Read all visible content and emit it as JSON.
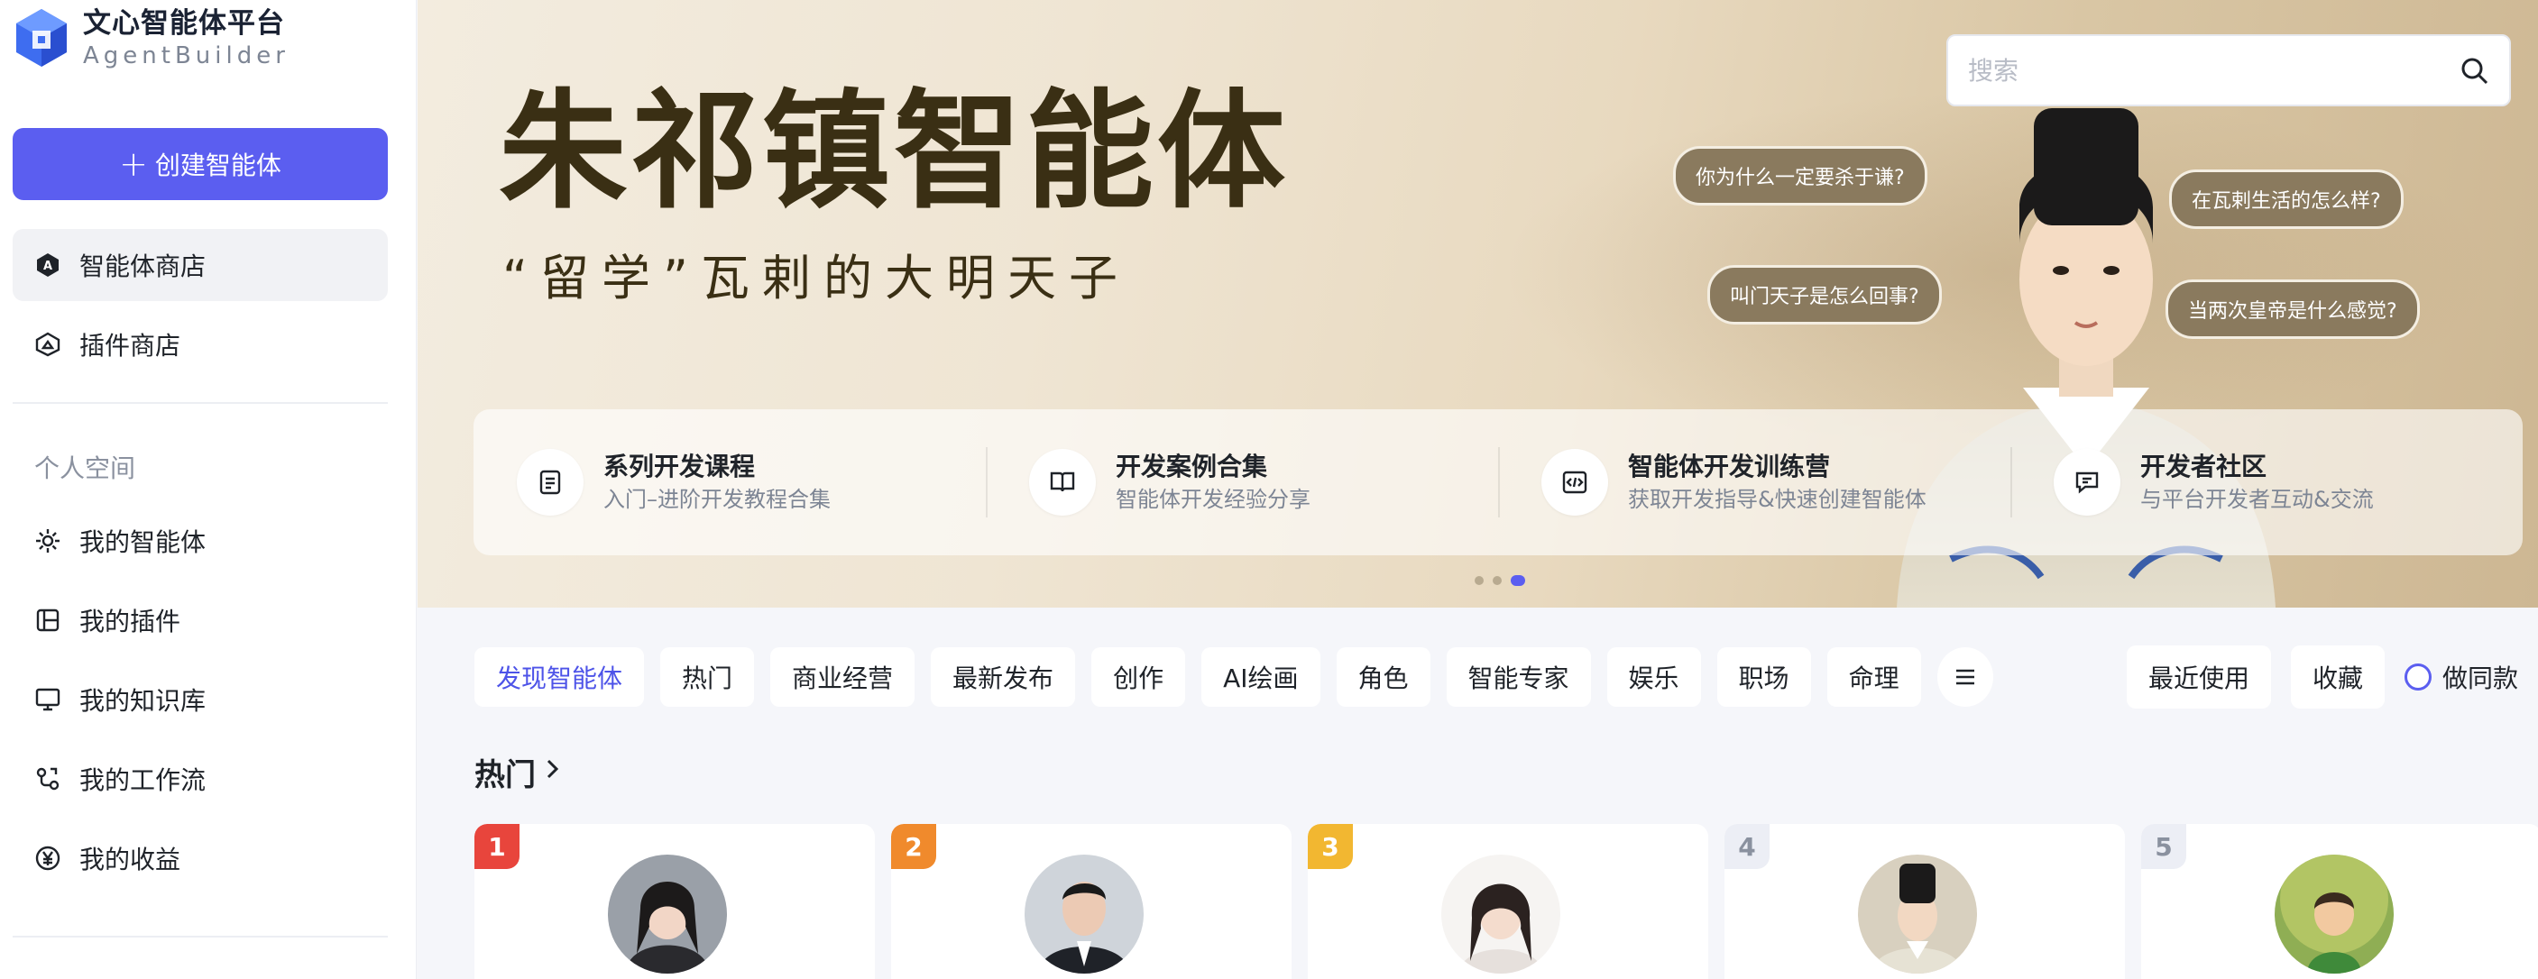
{
  "brand": {
    "name": "文心智能体平台",
    "sub": "AgentBuilder",
    "logo_icon": "hexagon-cube-logo"
  },
  "sidebar": {
    "create_label": "创建智能体",
    "nav": [
      {
        "label": "智能体商店",
        "icon": "store-a-icon"
      },
      {
        "label": "插件商店",
        "icon": "plugin-store-icon"
      }
    ],
    "section_label": "个人空间",
    "personal": [
      {
        "label": "我的智能体",
        "icon": "sparkle-icon"
      },
      {
        "label": "我的插件",
        "icon": "plugin-icon"
      },
      {
        "label": "我的知识库",
        "icon": "monitor-icon"
      },
      {
        "label": "我的工作流",
        "icon": "workflow-icon"
      },
      {
        "label": "我的收益",
        "icon": "yen-icon"
      }
    ]
  },
  "banner": {
    "title": "朱祁镇智能体",
    "subtitle": "“留学”瓦剌的大明天子",
    "bubbles": [
      "你为什么一定要杀于谦?",
      "叫门天子是怎么回事?",
      "在瓦剌生活的怎么样?",
      "当两次皇帝是什么感觉?"
    ],
    "active_slide": 3,
    "slide_count": 3
  },
  "search": {
    "placeholder": "搜索"
  },
  "quick_links": [
    {
      "title": "系列开发课程",
      "desc": "入门–进阶开发教程合集",
      "icon": "document-icon"
    },
    {
      "title": "开发案例合集",
      "desc": "智能体开发经验分享",
      "icon": "book-icon"
    },
    {
      "title": "智能体开发训练营",
      "desc": "获取开发指导&快速创建智能体",
      "icon": "code-icon"
    },
    {
      "title": "开发者社区",
      "desc": "与平台开发者互动&交流",
      "icon": "chat-icon"
    }
  ],
  "categories": [
    "发现智能体",
    "热门",
    "商业经营",
    "最新发布",
    "创作",
    "AI绘画",
    "角色",
    "智能专家",
    "娱乐",
    "职场",
    "命理"
  ],
  "right_tabs": [
    "最近使用",
    "收藏"
  ],
  "radio_label": "做同款",
  "hot_section": {
    "title": "热门"
  },
  "hot_cards": [
    {
      "rank": "1",
      "rank_color": "#e8453c"
    },
    {
      "rank": "2",
      "rank_color": "#f08a2c"
    },
    {
      "rank": "3",
      "rank_color": "#f2b731"
    },
    {
      "rank": "4",
      "rank_color": "#eceef5"
    },
    {
      "rank": "5",
      "rank_color": "#eceef5"
    }
  ],
  "colors": {
    "accent": "#5b5ef0",
    "banner_text": "#3a2f14"
  }
}
